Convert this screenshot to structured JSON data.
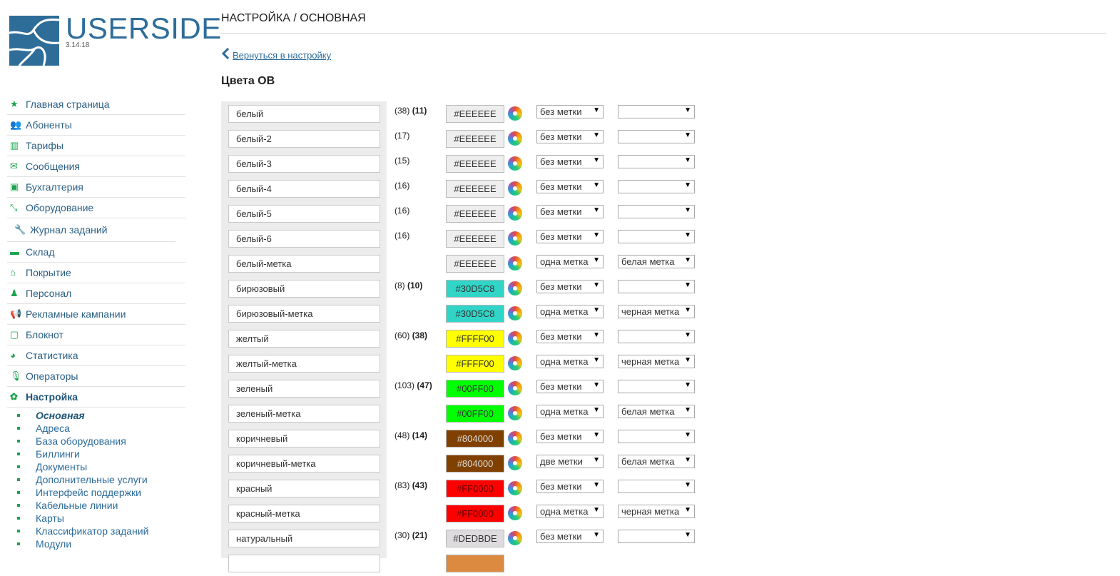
{
  "logo": {
    "name": "USERSIDE",
    "version": "3.14.18",
    "color": "#2f6d99"
  },
  "nav": {
    "items": [
      {
        "label": "Главная страница",
        "icon": "star-icon"
      },
      {
        "label": "Абоненты",
        "icon": "users-icon"
      },
      {
        "label": "Тарифы",
        "icon": "bar-chart-icon"
      },
      {
        "label": "Сообщения",
        "icon": "envelope-icon"
      },
      {
        "label": "Бухгалтерия",
        "icon": "money-icon"
      },
      {
        "label": "Оборудование",
        "icon": "compress-icon"
      },
      {
        "label": "Журнал заданий",
        "icon": "wrench-icon"
      },
      {
        "label": "Склад",
        "icon": "archive-icon"
      },
      {
        "label": "Покрытие",
        "icon": "home-icon"
      },
      {
        "label": "Персонал",
        "icon": "user-group-icon"
      },
      {
        "label": "Рекламные кампании",
        "icon": "bullhorn-icon"
      },
      {
        "label": "Блокнот",
        "icon": "notepad-icon"
      },
      {
        "label": "Статистика",
        "icon": "pie-chart-icon"
      },
      {
        "label": "Операторы",
        "icon": "microphone-icon"
      },
      {
        "label": "Настройка",
        "icon": "gear-icon"
      }
    ],
    "subitems": [
      "Основная",
      "Адреса",
      "База оборудования",
      "Биллинги",
      "Документы",
      "Дополнительные услуги",
      "Интерфейс поддержки",
      "Кабельные линии",
      "Карты",
      "Классификатор заданий",
      "Модули"
    ]
  },
  "page": {
    "title": "НАСТРОЙКА / ОСНОВНАЯ",
    "back_link": "Вернуться в настройку",
    "section_title": "Цвета ОВ"
  },
  "rows": [
    {
      "name": "белый",
      "count1": "(38)",
      "count2": "(11)",
      "hex": "#EEEEEE",
      "label_mode": "без метки",
      "label": ""
    },
    {
      "name": "белый-2",
      "count1": "(17)",
      "count2": "",
      "hex": "#EEEEEE",
      "label_mode": "без метки",
      "label": ""
    },
    {
      "name": "белый-3",
      "count1": "(15)",
      "count2": "",
      "hex": "#EEEEEE",
      "label_mode": "без метки",
      "label": ""
    },
    {
      "name": "белый-4",
      "count1": "(16)",
      "count2": "",
      "hex": "#EEEEEE",
      "label_mode": "без метки",
      "label": ""
    },
    {
      "name": "белый-5",
      "count1": "(16)",
      "count2": "",
      "hex": "#EEEEEE",
      "label_mode": "без метки",
      "label": ""
    },
    {
      "name": "белый-6",
      "count1": "(16)",
      "count2": "",
      "hex": "#EEEEEE",
      "label_mode": "без метки",
      "label": ""
    },
    {
      "name": "белый-метка",
      "count1": "",
      "count2": "",
      "hex": "#EEEEEE",
      "label_mode": "одна метка",
      "label": "белая метка"
    },
    {
      "name": "бирюзовый",
      "count1": "(8)",
      "count2": "(10)",
      "hex": "#30D5C8",
      "label_mode": "без метки",
      "label": ""
    },
    {
      "name": "бирюзовый-метка",
      "count1": "",
      "count2": "",
      "hex": "#30D5C8",
      "label_mode": "одна метка",
      "label": "черная метка"
    },
    {
      "name": "желтый",
      "count1": "(60)",
      "count2": "(38)",
      "hex": "#FFFF00",
      "label_mode": "без метки",
      "label": ""
    },
    {
      "name": "желтый-метка",
      "count1": "",
      "count2": "",
      "hex": "#FFFF00",
      "label_mode": "одна метка",
      "label": "черная метка"
    },
    {
      "name": "зеленый",
      "count1": "(103)",
      "count2": "(47)",
      "hex": "#00FF00",
      "label_mode": "без метки",
      "label": ""
    },
    {
      "name": "зеленый-метка",
      "count1": "",
      "count2": "",
      "hex": "#00FF00",
      "label_mode": "одна метка",
      "label": "белая метка"
    },
    {
      "name": "коричневый",
      "count1": "(48)",
      "count2": "(14)",
      "hex": "#804000",
      "label_mode": "без метки",
      "label": ""
    },
    {
      "name": "коричневый-метка",
      "count1": "",
      "count2": "",
      "hex": "#804000",
      "label_mode": "две метки",
      "label": "белая метка"
    },
    {
      "name": "красный",
      "count1": "(83)",
      "count2": "(43)",
      "hex": "#FF0000",
      "label_mode": "без метки",
      "label": ""
    },
    {
      "name": "красный-метка",
      "count1": "",
      "count2": "",
      "hex": "#FF0000",
      "label_mode": "одна метка",
      "label": "черная метка"
    },
    {
      "name": "натуральный",
      "count1": "(30)",
      "count2": "(21)",
      "hex": "#DEDBDE",
      "label_mode": "без метки",
      "label": ""
    },
    {
      "name": "",
      "count1": "",
      "count2": "",
      "hex": "#DB8A3F",
      "label_mode": "",
      "label": ""
    }
  ]
}
